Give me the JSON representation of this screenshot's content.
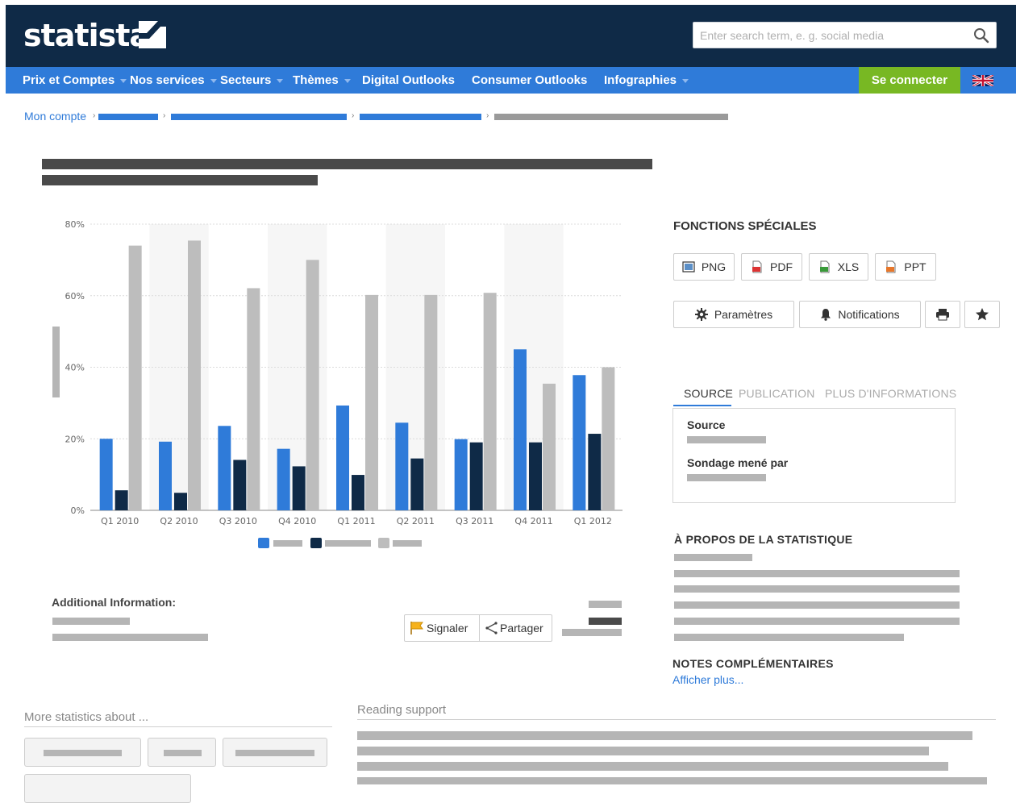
{
  "header": {
    "logo_text": "statista",
    "search_placeholder": "Enter search term, e. g. social media"
  },
  "nav": {
    "items": [
      {
        "label": "Prix et Comptes",
        "dropdown": true
      },
      {
        "label": "Nos services",
        "dropdown": true
      },
      {
        "label": "Secteurs",
        "dropdown": true
      },
      {
        "label": "Thèmes",
        "dropdown": true
      },
      {
        "label": "Digital Outlooks",
        "dropdown": false
      },
      {
        "label": "Consumer Outlooks",
        "dropdown": false
      },
      {
        "label": "Infographies",
        "dropdown": true
      }
    ],
    "login_label": "Se connecter",
    "language_flag": "uk-flag-icon"
  },
  "breadcrumb": {
    "home": "Mon compte"
  },
  "chart_data": {
    "type": "bar",
    "categories": [
      "Q1 2010",
      "Q2 2010",
      "Q3 2010",
      "Q4 2010",
      "Q1 2011",
      "Q2 2011",
      "Q3 2011",
      "Q4 2011",
      "Q1 2012"
    ],
    "series": [
      {
        "color": "#2f7bd9",
        "values": [
          20,
          19.2,
          23.6,
          17.2,
          29.3,
          24.5,
          19.9,
          45,
          37.8
        ]
      },
      {
        "color": "#0f2a47",
        "values": [
          5.6,
          4.9,
          14.1,
          12.3,
          9.9,
          14.5,
          19,
          19,
          21.4
        ]
      },
      {
        "color": "#bdbdbd",
        "values": [
          74,
          75.4,
          62.1,
          70,
          60.2,
          60.2,
          60.8,
          35.4,
          40
        ]
      }
    ],
    "y_ticks": [
      "0%",
      "20%",
      "40%",
      "60%",
      "80%"
    ],
    "ylim": [
      0,
      80
    ],
    "grid": true
  },
  "special_functions": {
    "title": "FONCTIONS SPÉCIALES",
    "export_buttons": [
      "PNG",
      "PDF",
      "XLS",
      "PPT"
    ],
    "settings_label": "Paramètres",
    "notifications_label": "Notifications"
  },
  "source_tabs": {
    "tabs": [
      "SOURCE",
      "PUBLICATION",
      "PLUS D'INFORMATIONS"
    ],
    "source_label": "Source",
    "survey_label": "Sondage mené par"
  },
  "about": {
    "title": "À PROPOS DE LA STATISTIQUE"
  },
  "notes": {
    "title": "NOTES COMPLÉMENTAIRES",
    "show_more": "Afficher plus..."
  },
  "additional_info": {
    "title": "Additional Information:"
  },
  "share": {
    "report_label": "Signaler",
    "share_label": "Partager"
  },
  "more_stats": {
    "title": "More statistics about ..."
  },
  "reading_support": {
    "title": "Reading support"
  }
}
